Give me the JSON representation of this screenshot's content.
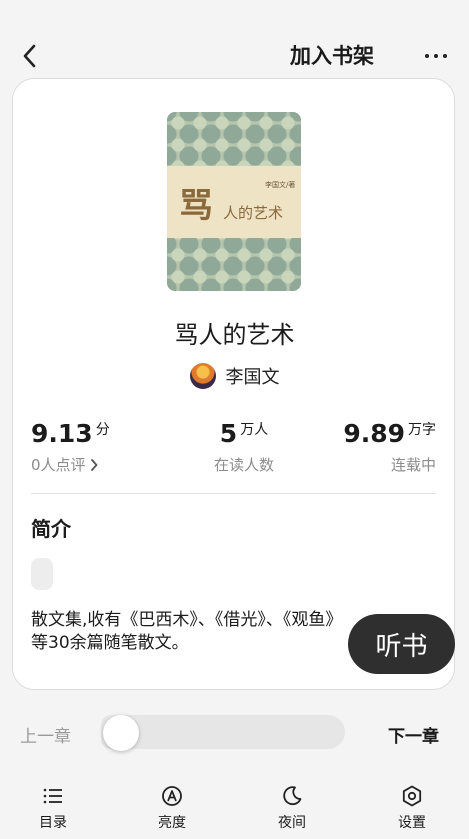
{
  "header": {
    "add_to_shelf": "加入书架"
  },
  "book": {
    "cover": {
      "big_char": "骂",
      "title": "人的艺术",
      "author_small": "李国文/著"
    },
    "title": "骂人的艺术",
    "author": "李国文"
  },
  "stats": {
    "score": {
      "value": "9.13",
      "unit": "分",
      "label": "0人点评"
    },
    "readers": {
      "value": "5",
      "unit": "万人",
      "label": "在读人数"
    },
    "words": {
      "value": "9.89",
      "unit": "万字",
      "label": "连载中"
    }
  },
  "intro": {
    "heading": "简介",
    "text_line1": "散文集,收有《巴西木》、《借光》、《观鱼》",
    "text_line2": "等30余篇随笔散文。"
  },
  "listen_button": "听书",
  "chapter": {
    "prev": "上一章",
    "next": "下一章",
    "progress": 0
  },
  "toolbar": {
    "items": [
      {
        "label": "目录",
        "icon": "list-icon"
      },
      {
        "label": "亮度",
        "icon": "brightness-icon"
      },
      {
        "label": "夜间",
        "icon": "moon-icon"
      },
      {
        "label": "设置",
        "icon": "settings-icon"
      }
    ]
  }
}
